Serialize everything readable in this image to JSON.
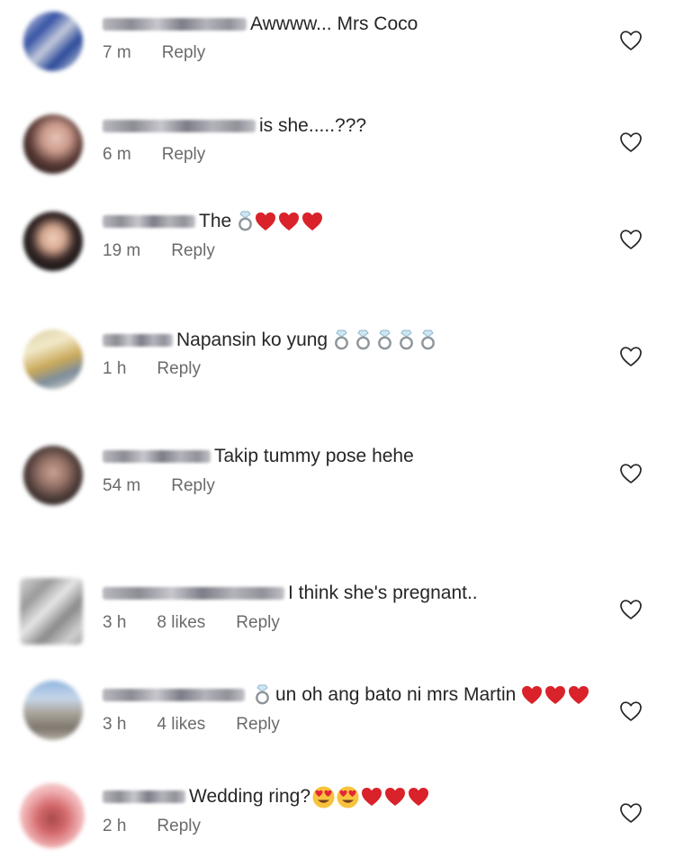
{
  "comments": [
    {
      "text": "Awwww... Mrs Coco",
      "time": "7 m",
      "likes": "",
      "reply": "Reply"
    },
    {
      "text": "is she.....???",
      "time": "6 m",
      "likes": "",
      "reply": "Reply"
    },
    {
      "text": "The",
      "time": "19 m",
      "likes": "",
      "reply": "Reply",
      "emoji": [
        "ring-icon",
        "red-heart-icon",
        "red-heart-icon",
        "red-heart-icon"
      ]
    },
    {
      "text": "Napansin ko yung",
      "time": "1 h",
      "likes": "",
      "reply": "Reply",
      "emoji": [
        "ring-icon",
        "ring-icon",
        "ring-icon",
        "ring-icon",
        "ring-icon"
      ]
    },
    {
      "text": "Takip tummy pose hehe",
      "time": "54 m",
      "likes": "",
      "reply": "Reply"
    },
    {
      "text": "I think she's pregnant..",
      "time": "3 h",
      "likes": "8 likes",
      "reply": "Reply"
    },
    {
      "text": "un oh ang bato ni mrs Martin",
      "time": "3 h",
      "likes": "4 likes",
      "reply": "Reply",
      "emoji_before": [
        "ring-icon"
      ],
      "emoji": [
        "red-heart-icon",
        "red-heart-icon",
        "red-heart-icon"
      ]
    },
    {
      "text": "Wedding ring?",
      "time": "2 h",
      "likes": "",
      "reply": "Reply",
      "emoji": [
        "heart-eyes-icon",
        "heart-eyes-icon",
        "red-heart-icon",
        "red-heart-icon",
        "red-heart-icon"
      ]
    }
  ],
  "colors": {
    "text": "#262626",
    "meta": "#6b6b6b",
    "heart_emoji": "#d9222a",
    "like_icon_stroke": "#262626"
  }
}
